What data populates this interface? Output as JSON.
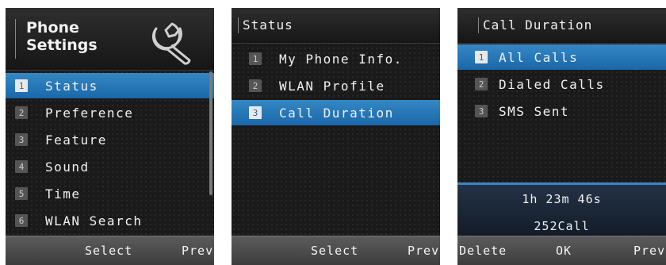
{
  "screen1": {
    "title_line1": "Phone",
    "title_line2": "Settings",
    "items": [
      {
        "num": "1",
        "label": "Status"
      },
      {
        "num": "2",
        "label": "Preference"
      },
      {
        "num": "3",
        "label": "Feature"
      },
      {
        "num": "4",
        "label": "Sound"
      },
      {
        "num": "5",
        "label": "Time"
      },
      {
        "num": "6",
        "label": "WLAN Search"
      }
    ],
    "softkeys": {
      "center": "Select",
      "right": "Prev"
    }
  },
  "screen2": {
    "title": "Status",
    "items": [
      {
        "num": "1",
        "label": "My Phone Info."
      },
      {
        "num": "2",
        "label": "WLAN Profile"
      },
      {
        "num": "3",
        "label": "Call Duration"
      }
    ],
    "softkeys": {
      "center": "Select",
      "right": "Prev"
    }
  },
  "screen3": {
    "title": "Call Duration",
    "items": [
      {
        "num": "1",
        "label": "All Calls"
      },
      {
        "num": "2",
        "label": "Dialed Calls"
      },
      {
        "num": "3",
        "label": "SMS Sent"
      }
    ],
    "summary": {
      "duration": "1h 23m 46s",
      "count": "252Call"
    },
    "softkeys": {
      "left": "Delete",
      "center": "OK",
      "right": "Prev"
    }
  },
  "colors": {
    "selected": "#1a67a9",
    "accent": "#3a86c8",
    "background": "#1a1a1a"
  },
  "icons": {
    "settings": "wrench-icon"
  }
}
